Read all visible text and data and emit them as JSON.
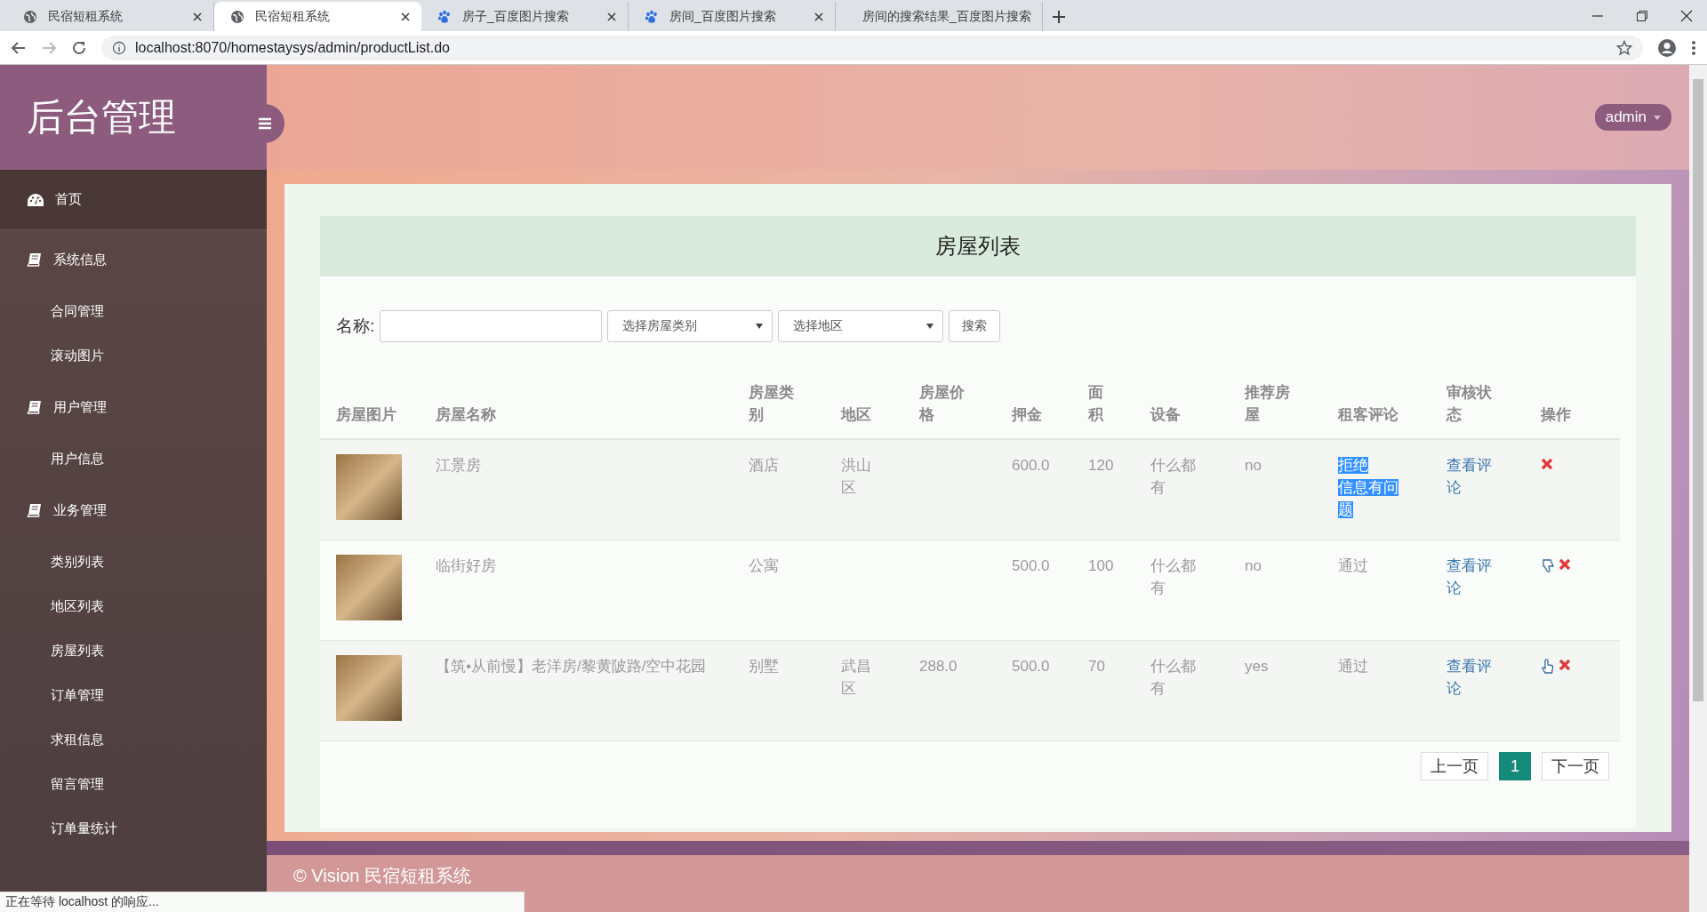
{
  "browser": {
    "tabs": [
      {
        "title": "民宿短租系统",
        "selected": false
      },
      {
        "title": "民宿短租系统",
        "selected": true
      },
      {
        "title": "房子_百度图片搜索",
        "selected": false
      },
      {
        "title": "房间_百度图片搜索",
        "selected": false
      },
      {
        "title": "房间的搜索结果_百度图片搜索",
        "selected": false
      }
    ],
    "url": "localhost:8070/homestaysys/admin/productList.do"
  },
  "sidebar": {
    "title": "后台管理",
    "items": [
      {
        "label": "首页",
        "selected": true
      },
      {
        "label": "系统信息",
        "selected": false,
        "children": [
          {
            "label": "合同管理"
          },
          {
            "label": "滚动图片"
          }
        ]
      },
      {
        "label": "用户管理",
        "selected": false,
        "children": [
          {
            "label": "用户信息"
          }
        ]
      },
      {
        "label": "业务管理",
        "selected": false,
        "children": [
          {
            "label": "类别列表"
          },
          {
            "label": "地区列表"
          },
          {
            "label": "房屋列表"
          },
          {
            "label": "订单管理"
          },
          {
            "label": "求租信息"
          },
          {
            "label": "留言管理"
          },
          {
            "label": "订单量统计"
          }
        ]
      }
    ]
  },
  "topbar": {
    "user": "admin"
  },
  "panel": {
    "title": "房屋列表",
    "search": {
      "label": "名称:",
      "selects": [
        "选择房屋类别",
        "选择地区"
      ],
      "button": "搜索"
    },
    "columns": [
      "房屋图片",
      "房屋名称",
      "房屋类别",
      "地区",
      "房屋价格",
      "押金",
      "面积",
      "设备",
      "推荐房屋",
      "租客评论",
      "审核状态",
      "操作"
    ],
    "rows": [
      {
        "name": "江景房",
        "type": "酒店",
        "region": "洪山区",
        "deposit": "600.0",
        "area": "120",
        "facilities": "什么都有",
        "recommended": "no",
        "comment": [
          "拒绝",
          "信息有问题"
        ],
        "comment_highlighted": true,
        "review": "查看评论",
        "actions": [
          {
            "kind": "delete"
          }
        ]
      },
      {
        "name": "临街好房",
        "type": "公寓",
        "deposit": "500.0",
        "area": "100",
        "facilities": "什么都有",
        "recommended": "no",
        "comment": [
          "通过"
        ],
        "comment_highlighted": false,
        "review": "查看评论",
        "actions": [
          {
            "kind": "unrecommend"
          },
          {
            "kind": "delete"
          }
        ]
      },
      {
        "name": "【筑•从前慢】老洋房/黎黄陂路/空中花园",
        "type": "别墅",
        "region": "武昌区",
        "price": "288.0",
        "deposit": "500.0",
        "area": "70",
        "facilities": "什么都有",
        "recommended": "yes",
        "comment": [
          "通过"
        ],
        "comment_highlighted": false,
        "review": "查看评论",
        "actions": [
          {
            "kind": "recommend"
          },
          {
            "kind": "delete"
          }
        ]
      }
    ],
    "pagination": {
      "prev": "上一页",
      "pages": [
        {
          "label": "1",
          "selected": true
        }
      ],
      "next": "下一页"
    }
  },
  "footer": "© Vision 民宿短租系统",
  "status_text": "正在等待 localhost 的响应..."
}
